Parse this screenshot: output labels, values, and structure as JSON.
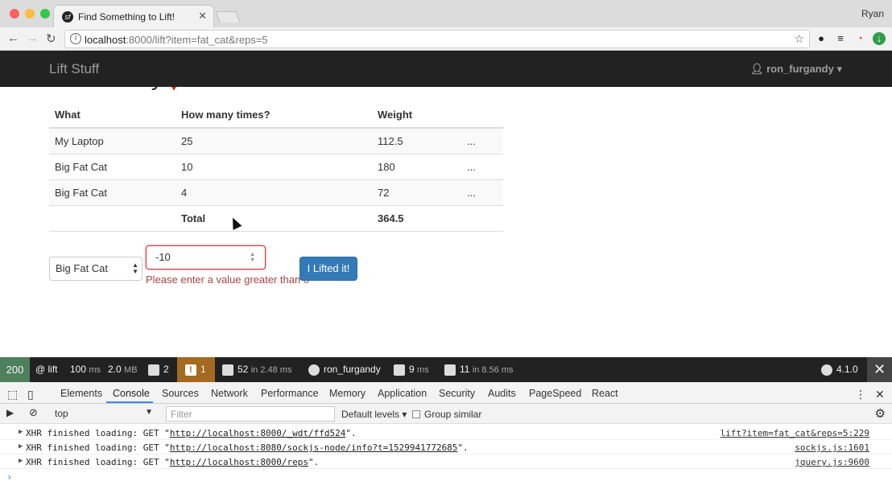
{
  "browser": {
    "tab_title": "Find Something to Lift!",
    "profile_name": "Ryan",
    "url_host": "localhost",
    "url_path": ":8000/lift?item=fat_cat&reps=5"
  },
  "navbar": {
    "brand": "Lift Stuff",
    "user": "ron_furgandy"
  },
  "page": {
    "heading": "Lift History!",
    "table": {
      "headers": [
        "What",
        "How many times?",
        "Weight",
        ""
      ],
      "rows": [
        {
          "what": "My Laptop",
          "times": "25",
          "weight": "112.5",
          "more": "..."
        },
        {
          "what": "Big Fat Cat",
          "times": "10",
          "weight": "180",
          "more": "..."
        },
        {
          "what": "Big Fat Cat",
          "times": "4",
          "weight": "72",
          "more": "..."
        }
      ],
      "total_label": "Total",
      "total_weight": "364.5"
    },
    "form": {
      "item_selected": "Big Fat Cat",
      "reps_value": "-10",
      "error": "Please enter a value greater than 0",
      "submit_label": "I Lifted it!"
    }
  },
  "symfony_toolbar": {
    "status": "200",
    "route": "@ lift",
    "time": "100",
    "time_unit": "ms",
    "memory": "2.0",
    "memory_unit": "MB",
    "forms": "2",
    "warnings": "1",
    "events": "52",
    "events_suffix": "in 2.48 ms",
    "user": "ron_furgandy",
    "render_time": "9",
    "render_unit": "ms",
    "db_queries": "11",
    "db_suffix": "in 8.56 ms",
    "version": "4.1.0"
  },
  "devtools": {
    "tabs": [
      "Elements",
      "Console",
      "Sources",
      "Network",
      "Performance",
      "Memory",
      "Application",
      "Security",
      "Audits",
      "PageSpeed",
      "React"
    ],
    "active_tab": "Console",
    "context": "top",
    "filter_placeholder": "Filter",
    "levels": "Default levels",
    "group_similar": "Group similar",
    "logs": [
      {
        "prefix": "XHR finished loading: GET \"",
        "url": "http://localhost:8000/_wdt/ffd524",
        "suffix": "\".",
        "source": "lift?item=fat_cat&reps=5:229"
      },
      {
        "prefix": "XHR finished loading: GET \"",
        "url": "http://localhost:8080/sockjs-node/info?t=1529941772685",
        "suffix": "\".",
        "source": "sockjs.js:1601"
      },
      {
        "prefix": "XHR finished loading: GET \"",
        "url": "http://localhost:8000/reps",
        "suffix": "\".",
        "source": "jquery.js:9600"
      }
    ]
  }
}
